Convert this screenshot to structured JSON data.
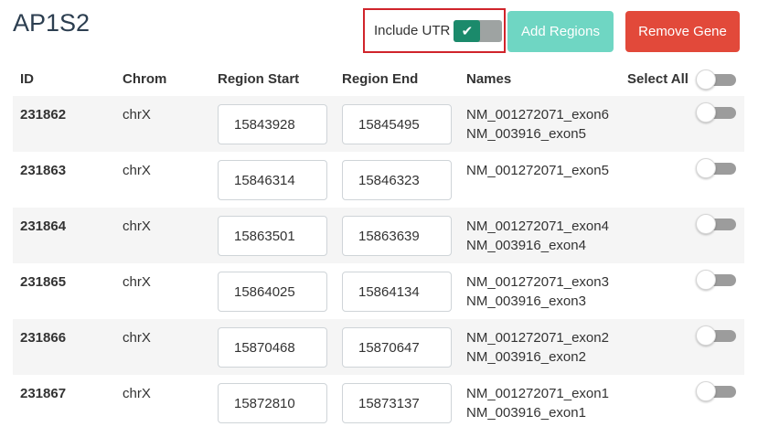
{
  "gene": {
    "title": "AP1S2"
  },
  "controls": {
    "include_utr_label": "Include UTR",
    "include_utr_checked": true,
    "add_regions_label": "Add Regions",
    "remove_gene_label": "Remove Gene"
  },
  "columns": {
    "id": "ID",
    "chrom": "Chrom",
    "region_start": "Region Start",
    "region_end": "Region End",
    "names": "Names",
    "select_all": "Select All"
  },
  "rows": [
    {
      "id": "231862",
      "chrom": "chrX",
      "start": "15843928",
      "end": "15845495",
      "names": [
        "NM_001272071_exon6",
        "NM_003916_exon5"
      ],
      "selected": false
    },
    {
      "id": "231863",
      "chrom": "chrX",
      "start": "15846314",
      "end": "15846323",
      "names": [
        "NM_001272071_exon5"
      ],
      "selected": false
    },
    {
      "id": "231864",
      "chrom": "chrX",
      "start": "15863501",
      "end": "15863639",
      "names": [
        "NM_001272071_exon4",
        "NM_003916_exon4"
      ],
      "selected": false
    },
    {
      "id": "231865",
      "chrom": "chrX",
      "start": "15864025",
      "end": "15864134",
      "names": [
        "NM_001272071_exon3",
        "NM_003916_exon3"
      ],
      "selected": false
    },
    {
      "id": "231866",
      "chrom": "chrX",
      "start": "15870468",
      "end": "15870647",
      "names": [
        "NM_001272071_exon2",
        "NM_003916_exon2"
      ],
      "selected": false
    },
    {
      "id": "231867",
      "chrom": "chrX",
      "start": "15872810",
      "end": "15873137",
      "names": [
        "NM_001272071_exon1",
        "NM_003916_exon1"
      ],
      "selected": false
    }
  ],
  "colors": {
    "utr_toggle_on": "#1b8a6b",
    "add_button": "#6fd6c3",
    "remove_button": "#e2493a",
    "highlight_border": "#d0242b"
  }
}
